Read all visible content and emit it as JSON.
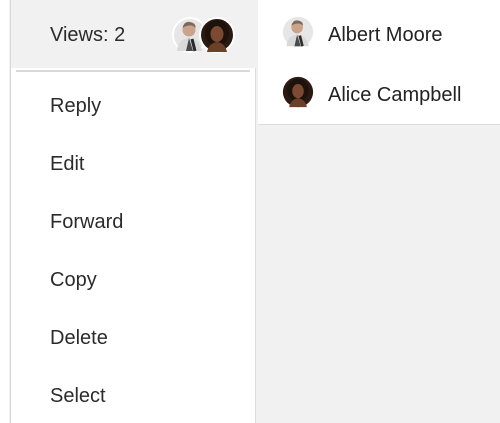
{
  "views_header": {
    "label": "Views: 2",
    "avatars": [
      "albert-moore-avatar",
      "alice-campbell-avatar"
    ]
  },
  "menu": {
    "items": [
      {
        "label": "Reply"
      },
      {
        "label": "Edit"
      },
      {
        "label": "Forward"
      },
      {
        "label": "Copy"
      },
      {
        "label": "Delete"
      },
      {
        "label": "Select"
      }
    ]
  },
  "viewers": {
    "list": [
      {
        "name": "Albert Moore",
        "avatar": "albert-moore-avatar"
      },
      {
        "name": "Alice Campbell",
        "avatar": "alice-campbell-avatar"
      }
    ]
  },
  "colors": {
    "menu_background": "#ffffff",
    "header_background": "#f1f1f1",
    "panel_background": "#f1f1f1",
    "divider": "#d9d9d9",
    "text": "#2b2b2b"
  }
}
